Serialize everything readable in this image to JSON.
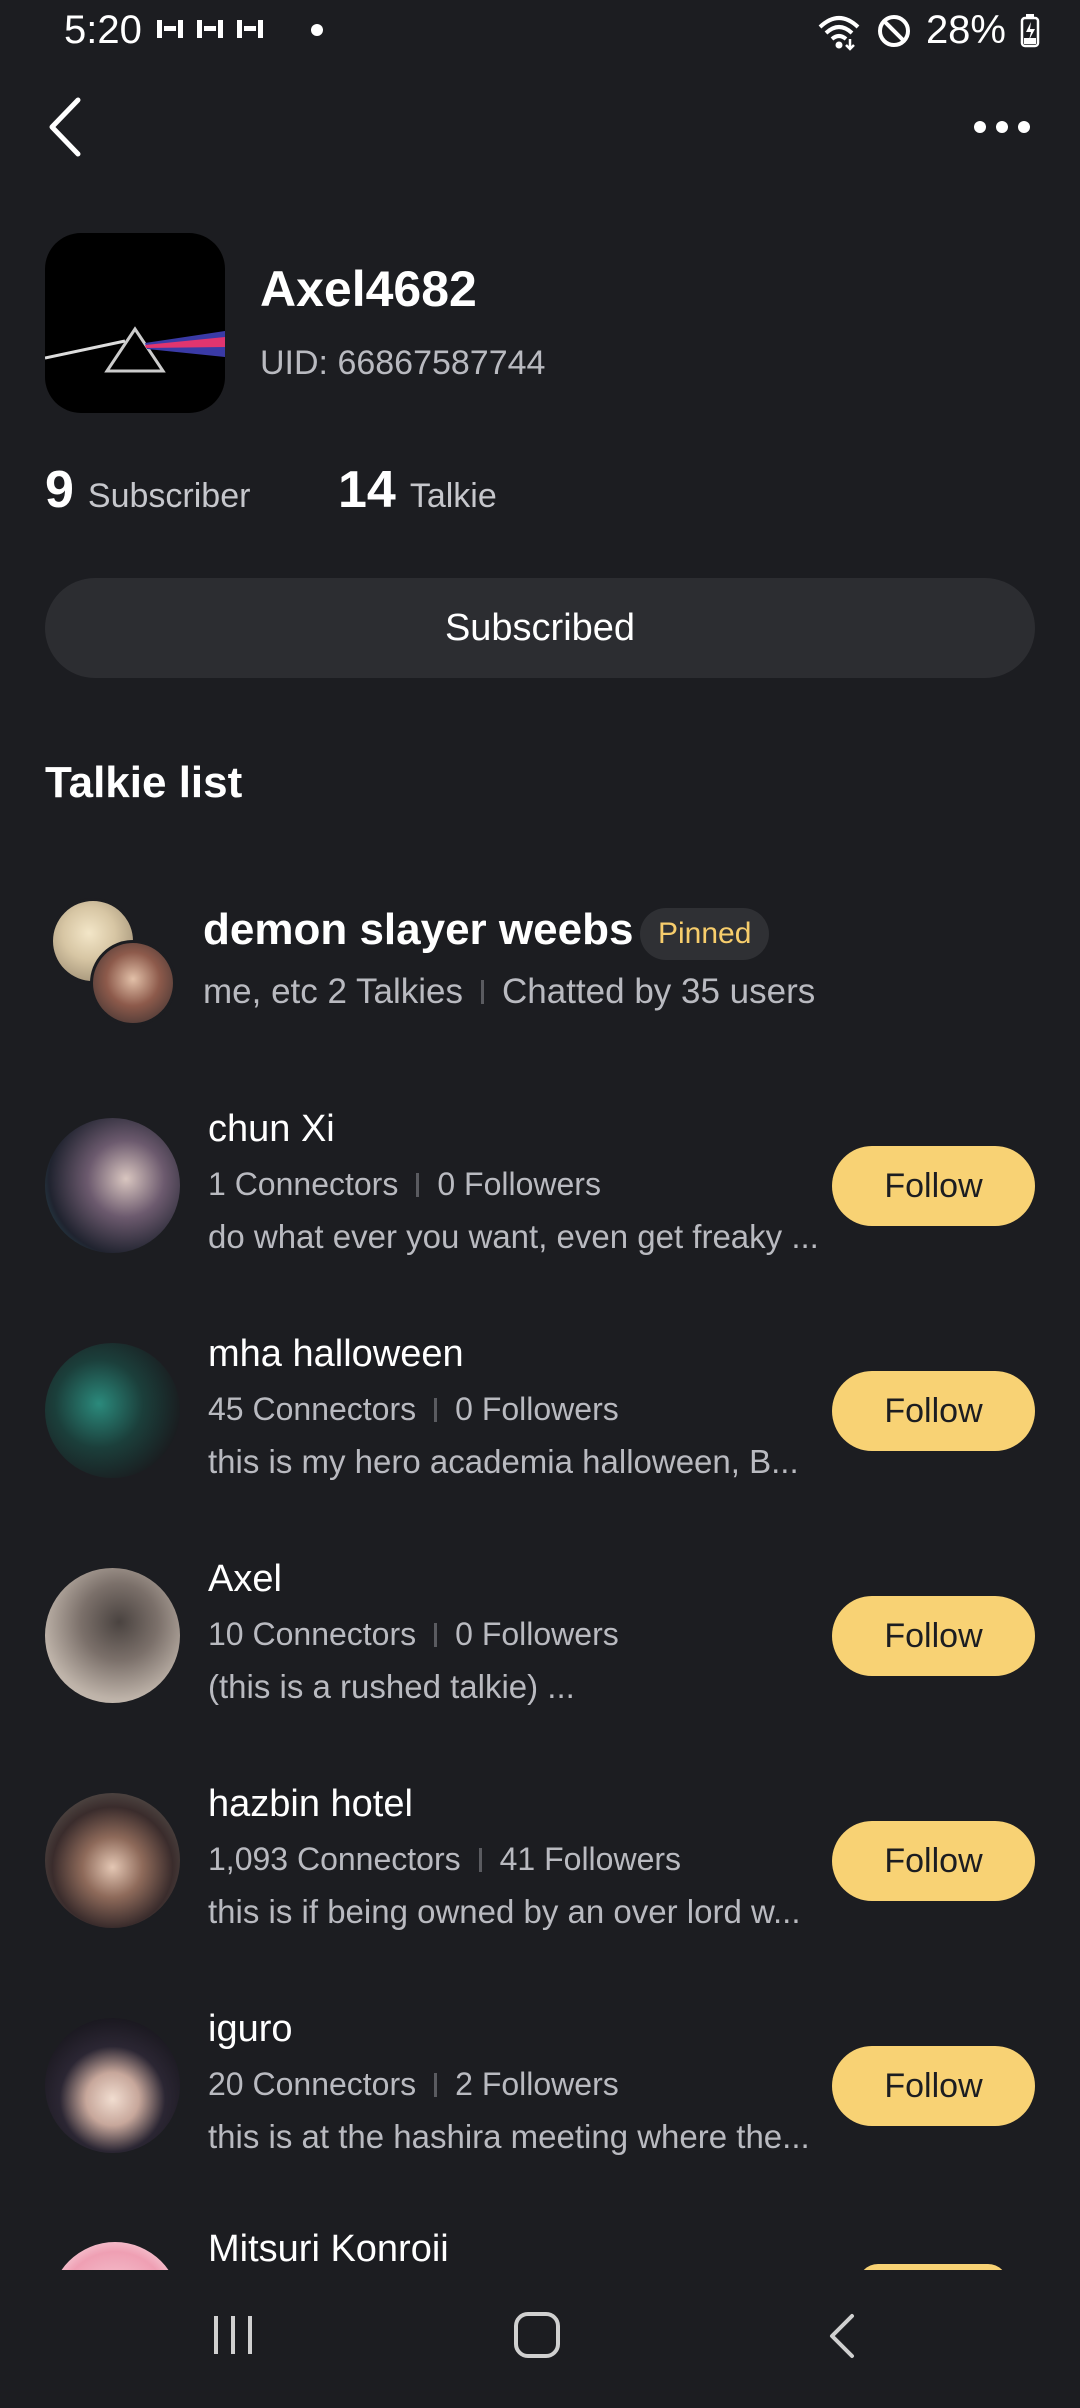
{
  "status_bar": {
    "time": "5:20",
    "battery": "28%"
  },
  "profile": {
    "name": "Axel4682",
    "uid": "UID: 66867587744"
  },
  "stats": [
    {
      "value": "9",
      "label": "Subscriber"
    },
    {
      "value": "14",
      "label": "Talkie"
    }
  ],
  "subscribe_button": "Subscribed",
  "section_title": "Talkie list",
  "pinned_group": {
    "title": "demon slayer weebs",
    "badge": "Pinned",
    "members": "me, etc 2 Talkies",
    "chatted": "Chatted by 35 users"
  },
  "talkies": [
    {
      "name": "chun Xi",
      "connectors": "1 Connectors",
      "followers": "0 Followers",
      "description": "do what ever you want, even get freaky ...",
      "button": "Follow"
    },
    {
      "name": "mha halloween",
      "connectors": "45 Connectors",
      "followers": "0 Followers",
      "description": "this is my hero academia halloween, B...",
      "button": "Follow"
    },
    {
      "name": "Axel",
      "connectors": "10 Connectors",
      "followers": "0 Followers",
      "description": "(this is a rushed talkie) ...",
      "button": "Follow"
    },
    {
      "name": "hazbin hotel",
      "connectors": "1,093 Connectors",
      "followers": "41 Followers",
      "description": "this is if being owned by an over lord w...",
      "button": "Follow"
    },
    {
      "name": "iguro",
      "connectors": "20 Connectors",
      "followers": "2 Followers",
      "description": "this is at the hashira meeting where the...",
      "button": "Follow"
    },
    {
      "name": "Mitsuri Konroii"
    }
  ],
  "colors": {
    "background": "#1c1d21",
    "accent": "#f8d274",
    "pinned_text": "#f7cd6c",
    "secondary_text": "#b9bac0"
  },
  "icons": {
    "back": "chevron-left-icon",
    "more": "more-horizontal-icon",
    "wifi": "wifi-icon",
    "dnd": "do-not-disturb-icon",
    "battery": "battery-charging-icon"
  }
}
